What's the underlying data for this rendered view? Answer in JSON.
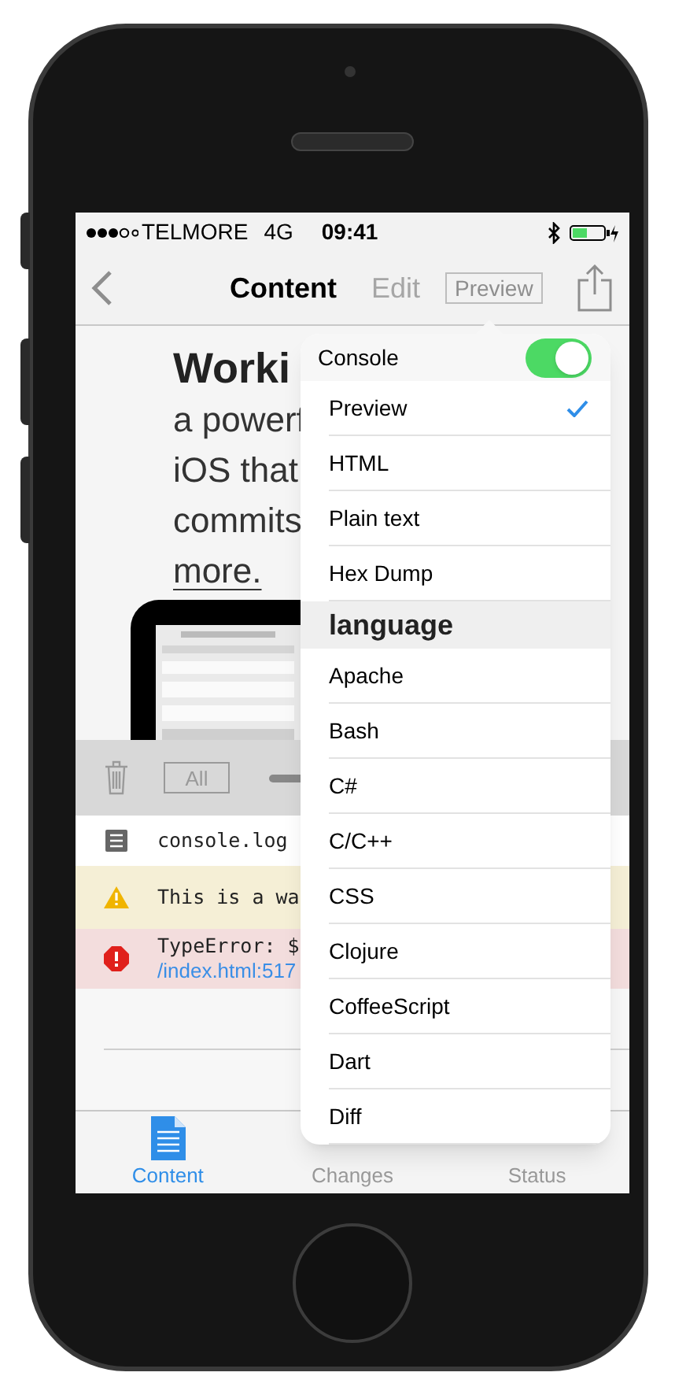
{
  "status_bar": {
    "carrier": "TELMORE",
    "network": "4G",
    "time": "09:41"
  },
  "nav_bar": {
    "title": "Content",
    "edit_button": "Edit",
    "preview_button": "Preview"
  },
  "article": {
    "heading": "Worki",
    "lines": [
      "a powerf",
      "iOS that",
      "commits",
      "more."
    ]
  },
  "console": {
    "filter_button": "All",
    "rows": [
      {
        "kind": "log",
        "text": "console.log"
      },
      {
        "kind": "warning",
        "text": "This is a wa"
      },
      {
        "kind": "error",
        "text": "TypeError: $",
        "link": "/index.html:517"
      }
    ]
  },
  "popover": {
    "console_toggle": {
      "label": "Console",
      "on": true
    },
    "items": [
      {
        "kind": "option",
        "label": "Preview",
        "selected": true
      },
      {
        "kind": "option",
        "label": "HTML",
        "selected": false
      },
      {
        "kind": "option",
        "label": "Plain text",
        "selected": false
      },
      {
        "kind": "option",
        "label": "Hex Dump",
        "selected": false
      },
      {
        "kind": "section",
        "label": "language"
      },
      {
        "kind": "option",
        "label": "Apache",
        "selected": false
      },
      {
        "kind": "option",
        "label": "Bash",
        "selected": false
      },
      {
        "kind": "option",
        "label": "C#",
        "selected": false
      },
      {
        "kind": "option",
        "label": "C/C++",
        "selected": false
      },
      {
        "kind": "option",
        "label": "CSS",
        "selected": false
      },
      {
        "kind": "option",
        "label": "Clojure",
        "selected": false
      },
      {
        "kind": "option",
        "label": "CoffeeScript",
        "selected": false
      },
      {
        "kind": "option",
        "label": "Dart",
        "selected": false
      },
      {
        "kind": "option",
        "label": "Diff",
        "selected": false
      }
    ]
  },
  "tab_bar": [
    {
      "label": "Content",
      "selected": true
    },
    {
      "label": "Changes",
      "selected": false
    },
    {
      "label": "Status",
      "selected": false
    }
  ]
}
